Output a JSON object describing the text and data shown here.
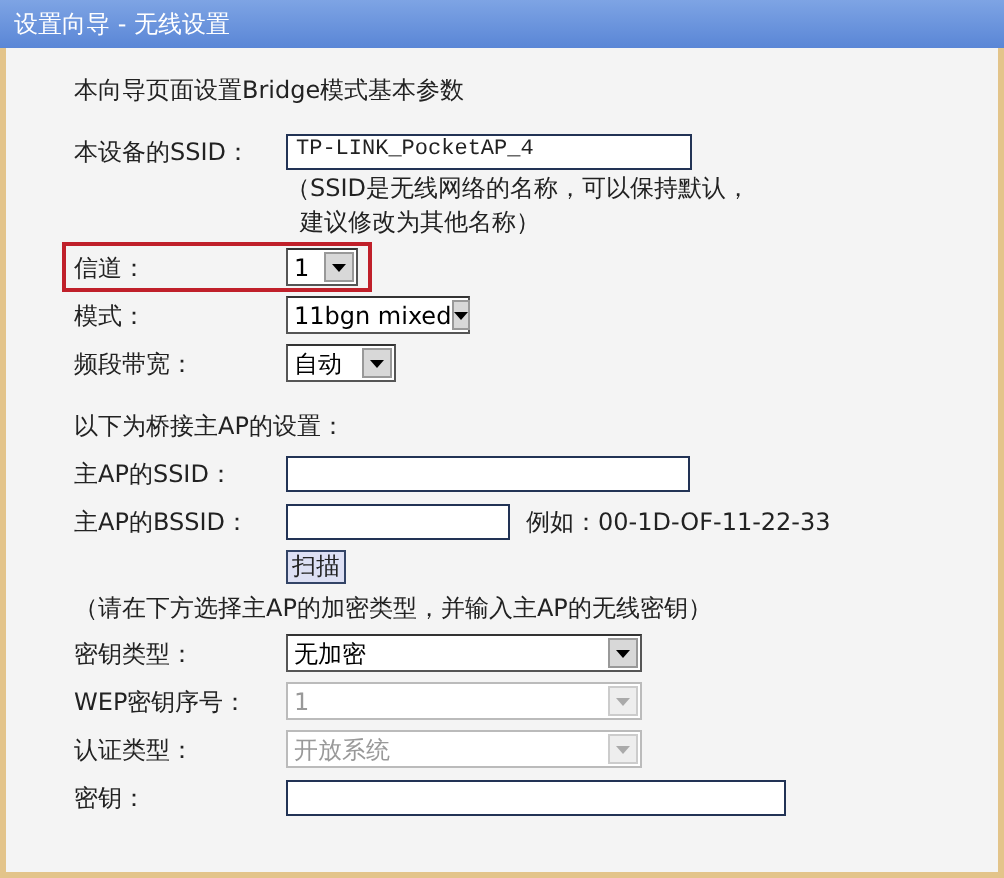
{
  "title": "设置向导 - 无线设置",
  "rows": [
    {
      "kind": "heading",
      "text": "本向导页面设置Bridge模式基本参数"
    },
    {
      "kind": "text",
      "label": "本设备的SSID：",
      "value": "TP-LINK_PocketAP_4"
    },
    {
      "kind": "note",
      "lines": [
        "（SSID是无线网络的名称，可以保持默认，",
        "建议修改为其他名称）"
      ]
    },
    {
      "kind": "select",
      "label": "信道：",
      "value": "1",
      "highlighted": true,
      "disabled": false
    },
    {
      "kind": "select",
      "label": "模式：",
      "value": "11bgn mixed",
      "highlighted": false,
      "disabled": false
    },
    {
      "kind": "select",
      "label": "频段带宽：",
      "value": "自动",
      "highlighted": false,
      "disabled": false
    },
    {
      "kind": "heading",
      "text": "以下为桥接主AP的设置："
    },
    {
      "kind": "text",
      "label": "主AP的SSID："
    },
    {
      "kind": "text",
      "label": "主AP的BSSID：",
      "hint": "例如：00-1D-OF-11-22-33"
    },
    {
      "kind": "button",
      "text": "扫描"
    },
    {
      "kind": "remark",
      "text": "（请在下方选择主AP的加密类型，并输入主AP的无线密钥）"
    },
    {
      "kind": "select",
      "label": "密钥类型：",
      "value": "无加密",
      "highlighted": false,
      "disabled": false
    },
    {
      "kind": "select",
      "label": "WEP密钥序号：",
      "value": "1",
      "highlighted": false,
      "disabled": true
    },
    {
      "kind": "select",
      "label": "认证类型：",
      "value": "开放系统",
      "highlighted": false,
      "disabled": true
    },
    {
      "kind": "text",
      "label": "密钥："
    }
  ]
}
